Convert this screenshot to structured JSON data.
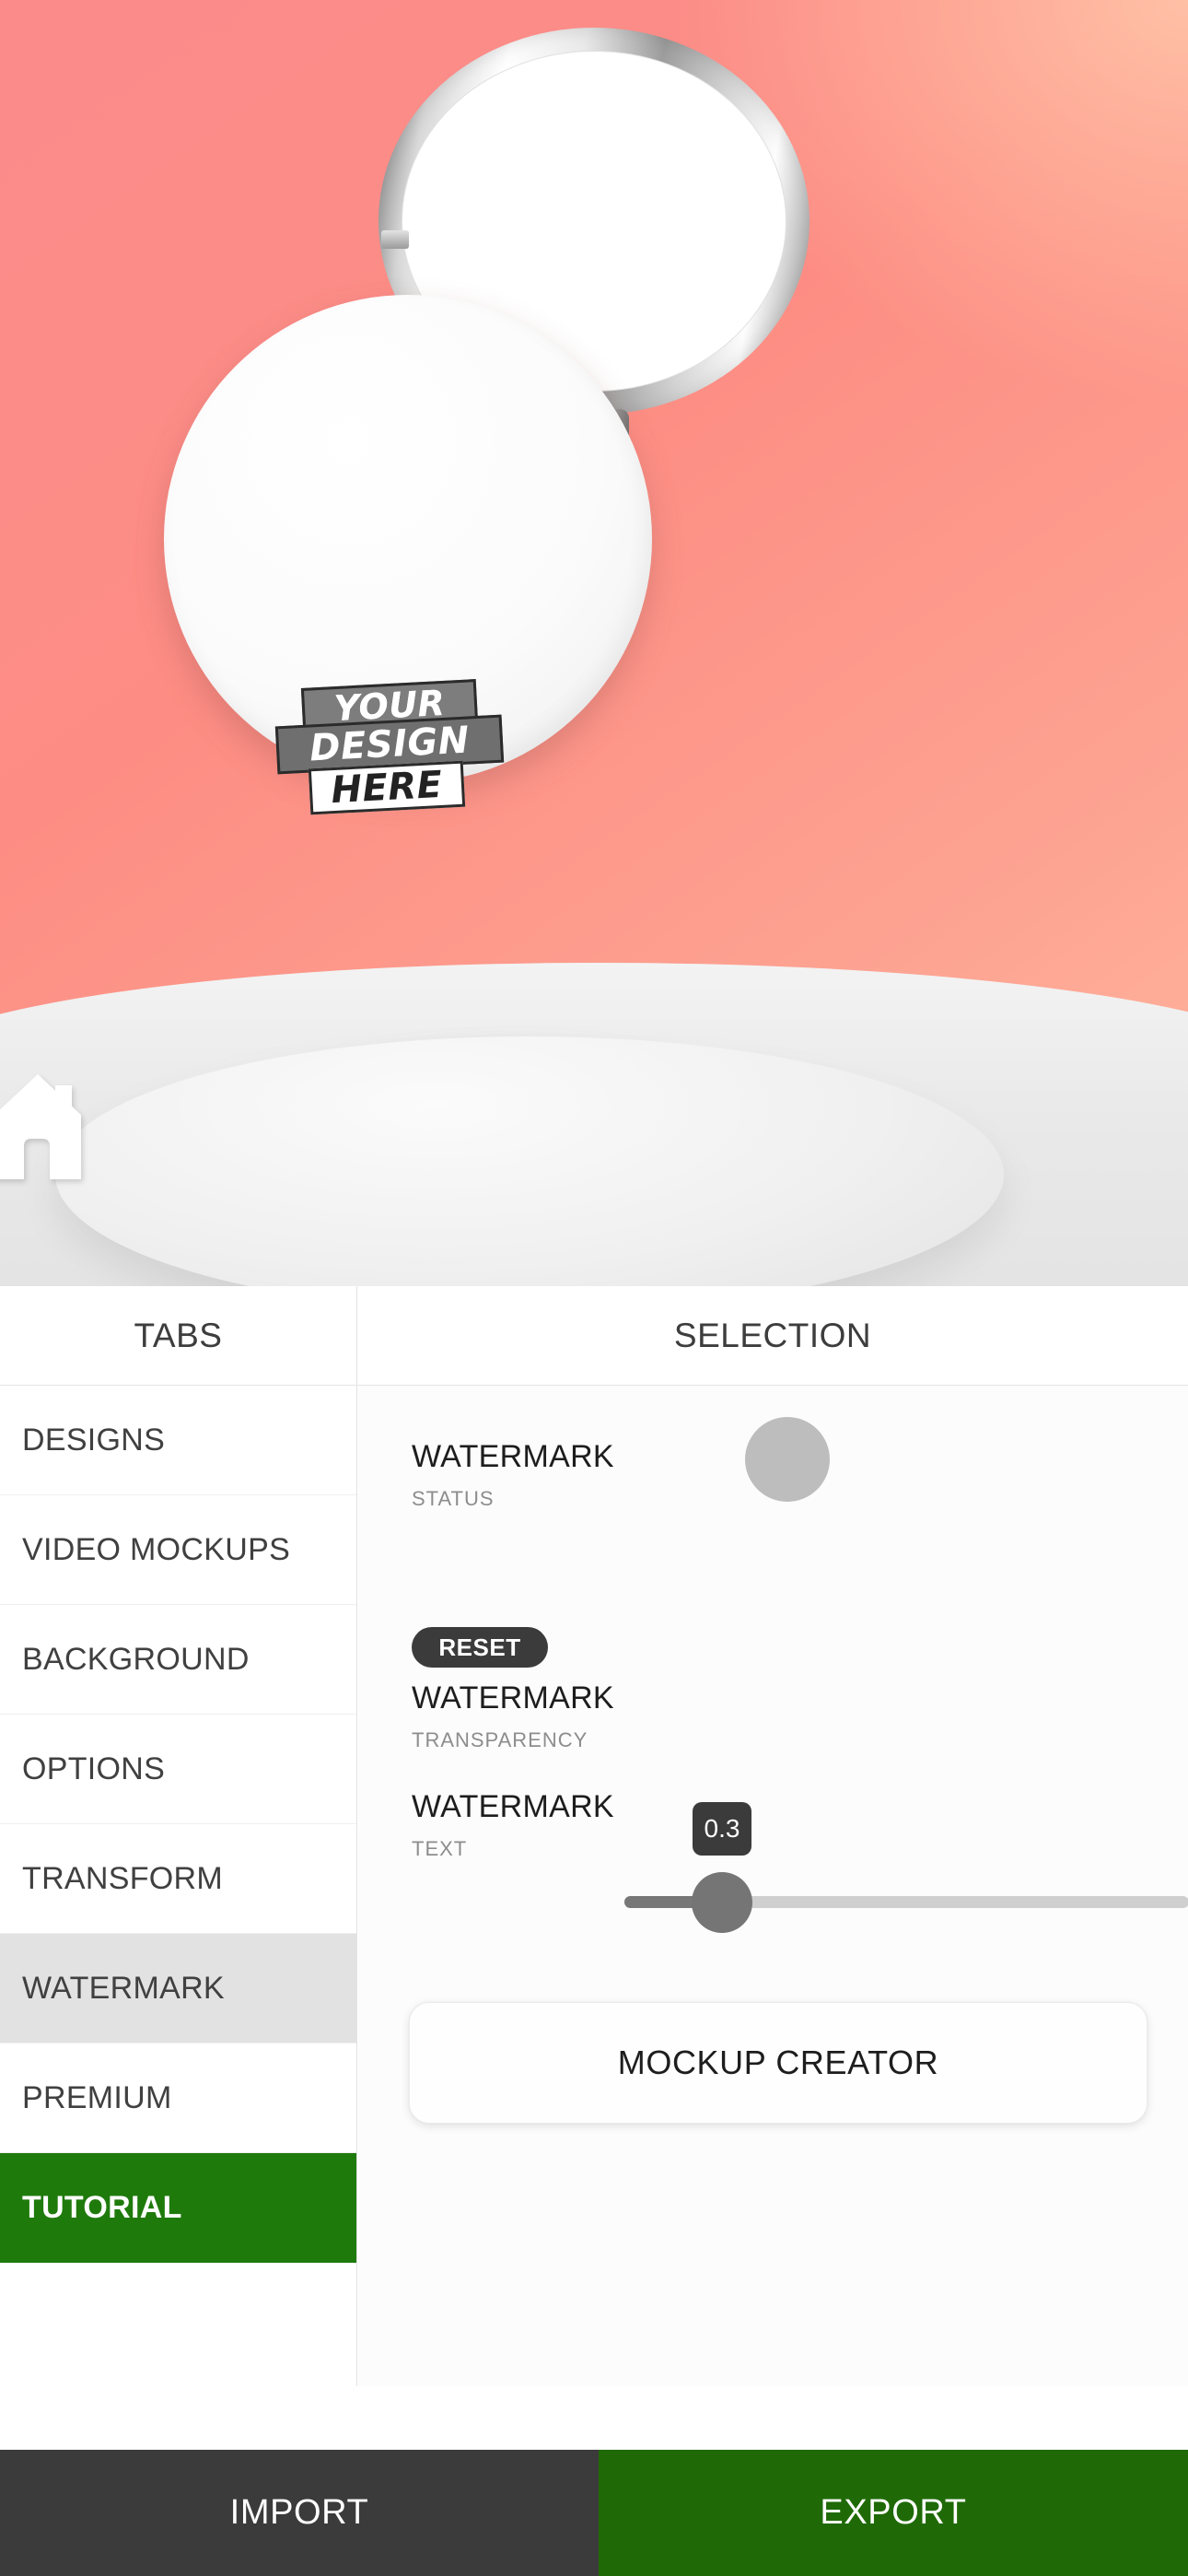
{
  "preview": {
    "artwork_lines": [
      "YOUR",
      "DESIGN",
      "HERE"
    ],
    "home_icon": "home-icon",
    "background_color": "#fb8b8b",
    "accent_peach": "#ffc0a6"
  },
  "panel_headers": {
    "tabs": "TABS",
    "selection": "SELECTION"
  },
  "sidebar": {
    "items": [
      {
        "label": "DESIGNS",
        "state": "normal"
      },
      {
        "label": "VIDEO MOCKUPS",
        "state": "normal"
      },
      {
        "label": "BACKGROUND",
        "state": "normal"
      },
      {
        "label": "OPTIONS",
        "state": "normal"
      },
      {
        "label": "TRANSFORM",
        "state": "normal"
      },
      {
        "label": "WATERMARK",
        "state": "active"
      },
      {
        "label": "PREMIUM",
        "state": "normal"
      },
      {
        "label": "TUTORIAL",
        "state": "accent"
      }
    ]
  },
  "selection": {
    "status_row": {
      "label": "WATERMARK",
      "sub": "STATUS",
      "toggle_state": "off",
      "toggle_color": "#bdbdbd"
    },
    "transparency_row": {
      "reset_label": "RESET",
      "label": "WATERMARK",
      "sub": "TRANSPARENCY",
      "value": "0.3",
      "min": 0,
      "max": 1,
      "fill_percent": 17
    },
    "text_row": {
      "label": "WATERMARK",
      "sub": "TEXT"
    },
    "creator_button": "MOCKUP CREATOR"
  },
  "bottom_bar": {
    "import_label": "IMPORT",
    "export_label": "EXPORT",
    "import_color": "#3b3b3b",
    "export_color": "#1f6a06"
  }
}
